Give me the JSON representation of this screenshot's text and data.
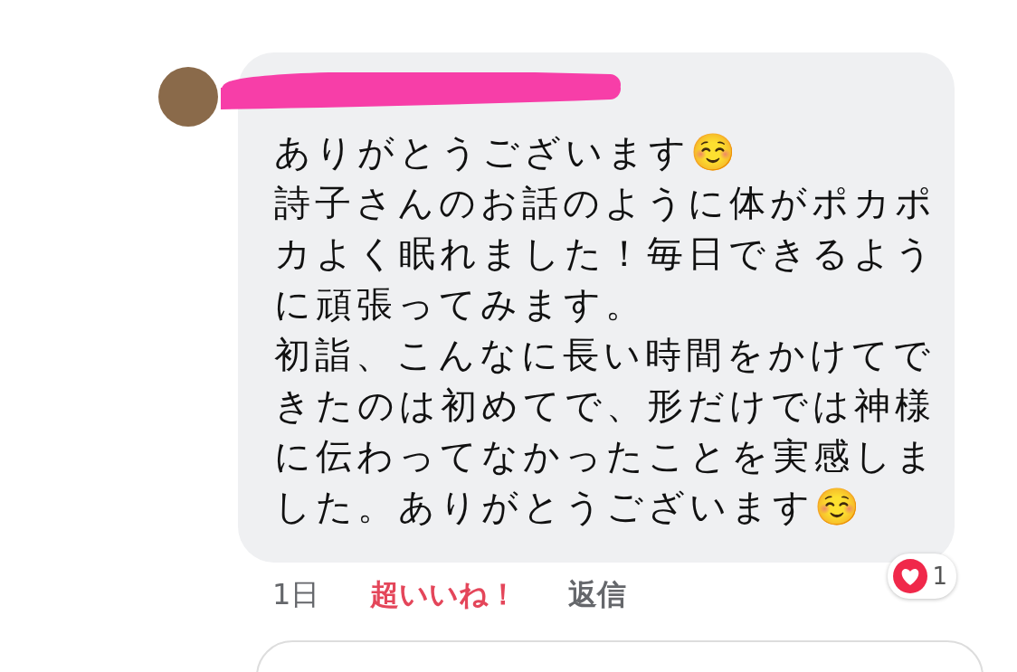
{
  "comment": {
    "author_redacted": true,
    "paragraphs": [
      "ありがとうございます☺️",
      "詩子さんのお話のように体がポカポカよく眠れました！毎日できるように頑張ってみます。",
      "初詣、こんなに長い時間をかけてできたのは初めてで、形だけでは神様に伝わってなかったことを実感しました。ありがとうございます☺️"
    ],
    "reaction_count": "1",
    "time": "1日",
    "like": {
      "label": "超いいね！",
      "active": true
    },
    "reply": "返信"
  }
}
